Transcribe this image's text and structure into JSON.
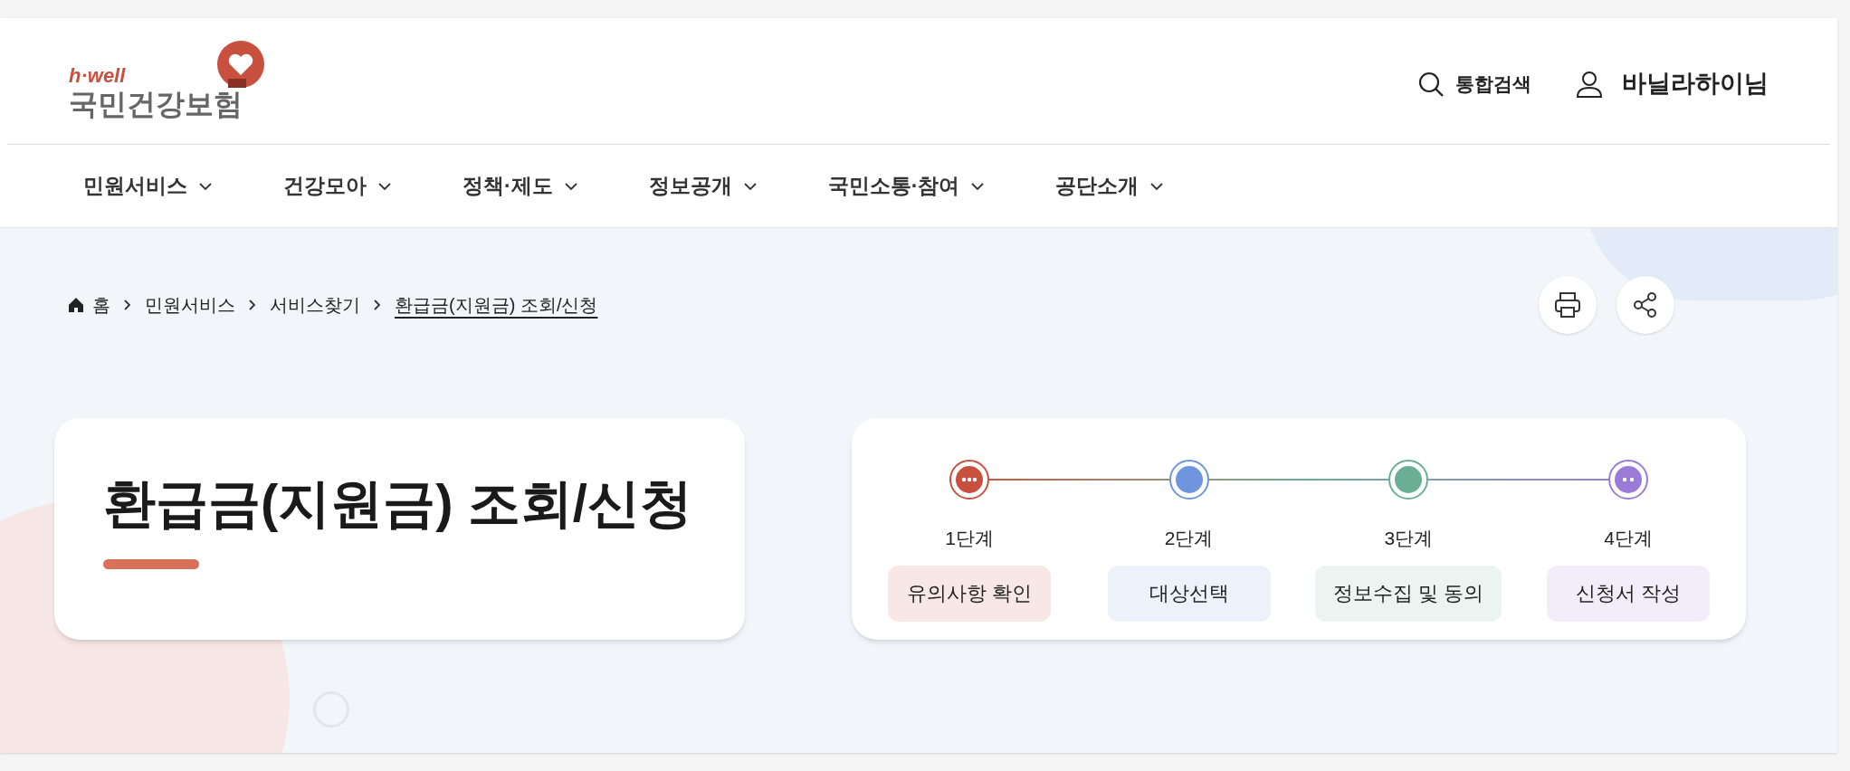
{
  "header": {
    "logo": {
      "tagline": "h·well",
      "name": "국민건강보험"
    },
    "search_label": "통합검색",
    "user_name": "바닐라하이님"
  },
  "nav": [
    {
      "label": "민원서비스"
    },
    {
      "label": "건강모아"
    },
    {
      "label": "정책·제도"
    },
    {
      "label": "정보공개"
    },
    {
      "label": "국민소통·참여"
    },
    {
      "label": "공단소개"
    }
  ],
  "breadcrumb": [
    {
      "label": "홈",
      "selected": false
    },
    {
      "label": "민원서비스",
      "selected": false
    },
    {
      "label": "서비스찾기",
      "selected": false
    },
    {
      "label": "환급금(지원금) 조회/신청",
      "selected": true
    }
  ],
  "page_title": "환급금(지원금) 조회/신청",
  "steps": [
    {
      "step": "1단계",
      "label": "유의사항 확인",
      "color": "#c8503f",
      "kind": "dots"
    },
    {
      "step": "2단계",
      "label": "대상선택",
      "color": "#6e95dd",
      "kind": "plain"
    },
    {
      "step": "3단계",
      "label": "정보수집 및 동의",
      "color": "#6aae95",
      "kind": "plain"
    },
    {
      "step": "4단계",
      "label": "신청서 작성",
      "color": "#9a7bd8",
      "kind": "dots"
    }
  ]
}
